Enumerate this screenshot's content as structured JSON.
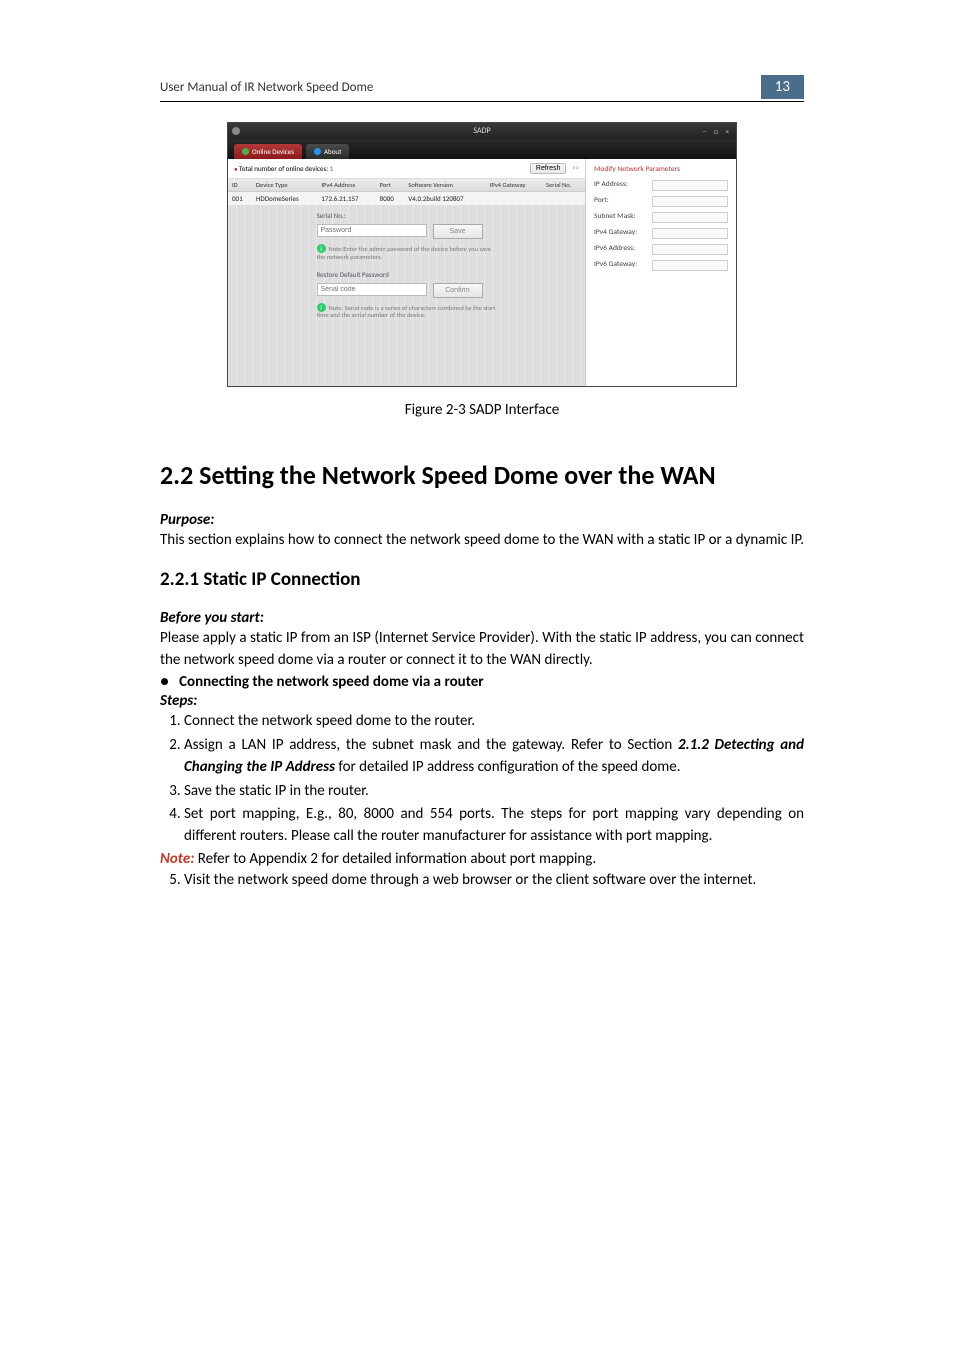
{
  "header": {
    "title": "User Manual of IR Network Speed Dome",
    "page_number": "13"
  },
  "screenshot": {
    "window_title": "SADP",
    "win_controls": "–  □  ×",
    "tabs": {
      "online": "Online Devices",
      "about": "About"
    },
    "total_label": "Total number of online devices:",
    "total_num": "1",
    "refresh": "Refresh",
    "collapse": ">>",
    "columns": {
      "id": "ID",
      "type": "Device Type",
      "ipv4": "IPv4 Address",
      "port": "Port",
      "sw": "Software Version",
      "gw": "IPv4 Gateway",
      "sn": "Serial No."
    },
    "row": {
      "id": "001",
      "type": "HDDomeSeries",
      "ipv4": "172.6.21.157",
      "port": "8000",
      "sw": "V4.0.2build 120807",
      "gw": "",
      "sn": ""
    },
    "form": {
      "serial_lbl": "Serial No.:",
      "pwd_placeholder": "Password",
      "save": "Save",
      "note1": "Note:Enter the admin password of the device before you save the network parameters.",
      "restore_hdr": "Restore Default Password",
      "serial_code_placeholder": "Serial code",
      "confirm": "Confirm",
      "note2": "Note: Serial code is a series of characters combined by the start time and the serial number of the device."
    },
    "right": {
      "header": "Modify Network Parameters",
      "ip": "IP Address:",
      "port": "Port:",
      "mask": "Subnet Mask:",
      "gw4": "IPv4 Gateway:",
      "ip6": "IPv6 Address:",
      "gw6": "IPv6 Gateway:"
    }
  },
  "figure_caption": "Figure 2-3 SADP Interface",
  "sec22": {
    "heading": "2.2  Setting the Network Speed Dome over the WAN",
    "purpose_label": "Purpose:",
    "purpose_text": "This section explains how to connect the network speed dome to the WAN with a static IP or a dynamic IP."
  },
  "sec221": {
    "heading": "2.2.1  Static IP Connection",
    "before_label": "Before you start:",
    "before_text": "Please apply a static IP from an ISP (Internet Service Provider). With the static IP address, you can connect the network speed dome via a router or connect it to the WAN directly.",
    "bullet": "Connecting the network speed dome via a router",
    "steps_label": "Steps:",
    "steps": {
      "s1": "Connect the network speed dome to the router.",
      "s2a": "Assign a LAN IP address, the subnet mask and the gateway. Refer to Section ",
      "s2b": "2.1.2 Detecting and Changing the IP Address",
      "s2c": " for detailed IP address configuration of the speed dome.",
      "s3": "Save the static IP in the router.",
      "s4": "Set port mapping, E.g., 80, 8000 and 554 ports. The steps for port mapping vary depending on different routers. Please call the router manufacturer for assistance with port mapping.",
      "s5": "Visit the network speed dome through a web browser or the client software over the internet."
    },
    "note_label": "Note:",
    "note_text": " Refer to Appendix 2 for detailed information about port mapping."
  }
}
